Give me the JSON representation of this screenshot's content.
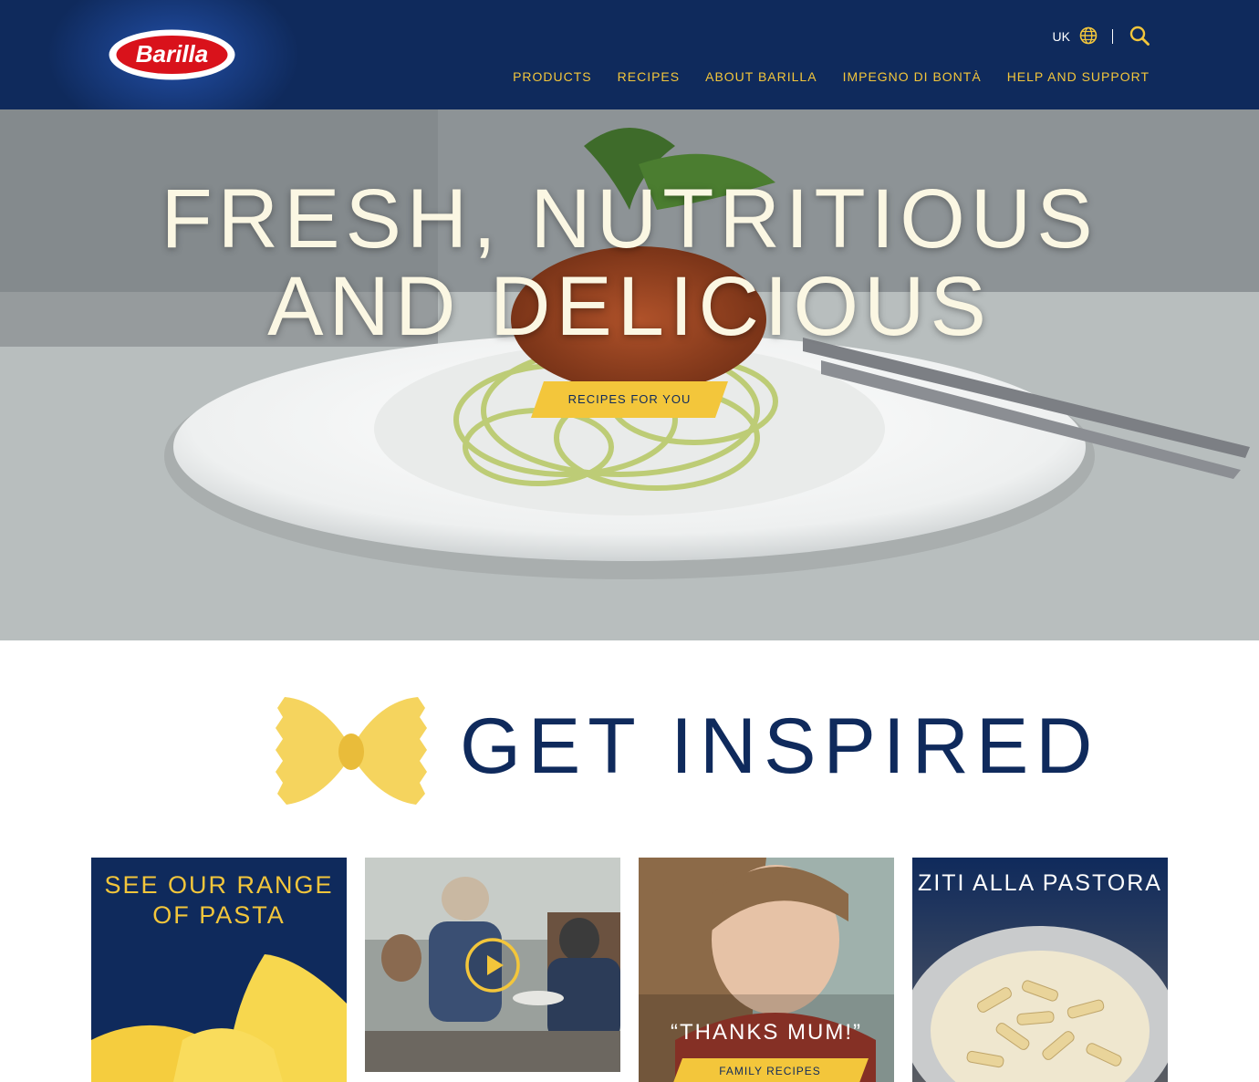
{
  "brand": {
    "logo_text": "Barilla"
  },
  "header": {
    "region_label": "UK",
    "nav": [
      {
        "label": "PRODUCTS"
      },
      {
        "label": "RECIPES"
      },
      {
        "label": "ABOUT BARILLA"
      },
      {
        "label": "IMPEGNO DI BONTÀ"
      },
      {
        "label": "HELP AND SUPPORT"
      }
    ]
  },
  "hero": {
    "title_line1": "FRESH, NUTRITIOUS",
    "title_line2": "AND DELICIOUS",
    "cta_label": "RECIPES FOR YOU"
  },
  "inspired": {
    "title": "GET INSPIRED"
  },
  "cards": [
    {
      "title_line1": "SEE OUR RANGE",
      "title_line2": "OF PASTA"
    },
    {
      "kind": "video"
    },
    {
      "quote": "“THANKS MUM!”",
      "cta_label": "FAMILY RECIPES"
    },
    {
      "title": "ZITI ALLA PASTORA"
    }
  ],
  "colors": {
    "navy": "#0f2a5c",
    "yellow": "#f3c63b",
    "cream": "#fbf7e3",
    "logo_red": "#d9121b"
  },
  "icons": [
    "globe-icon",
    "search-icon",
    "play-icon",
    "farfalle-icon"
  ]
}
